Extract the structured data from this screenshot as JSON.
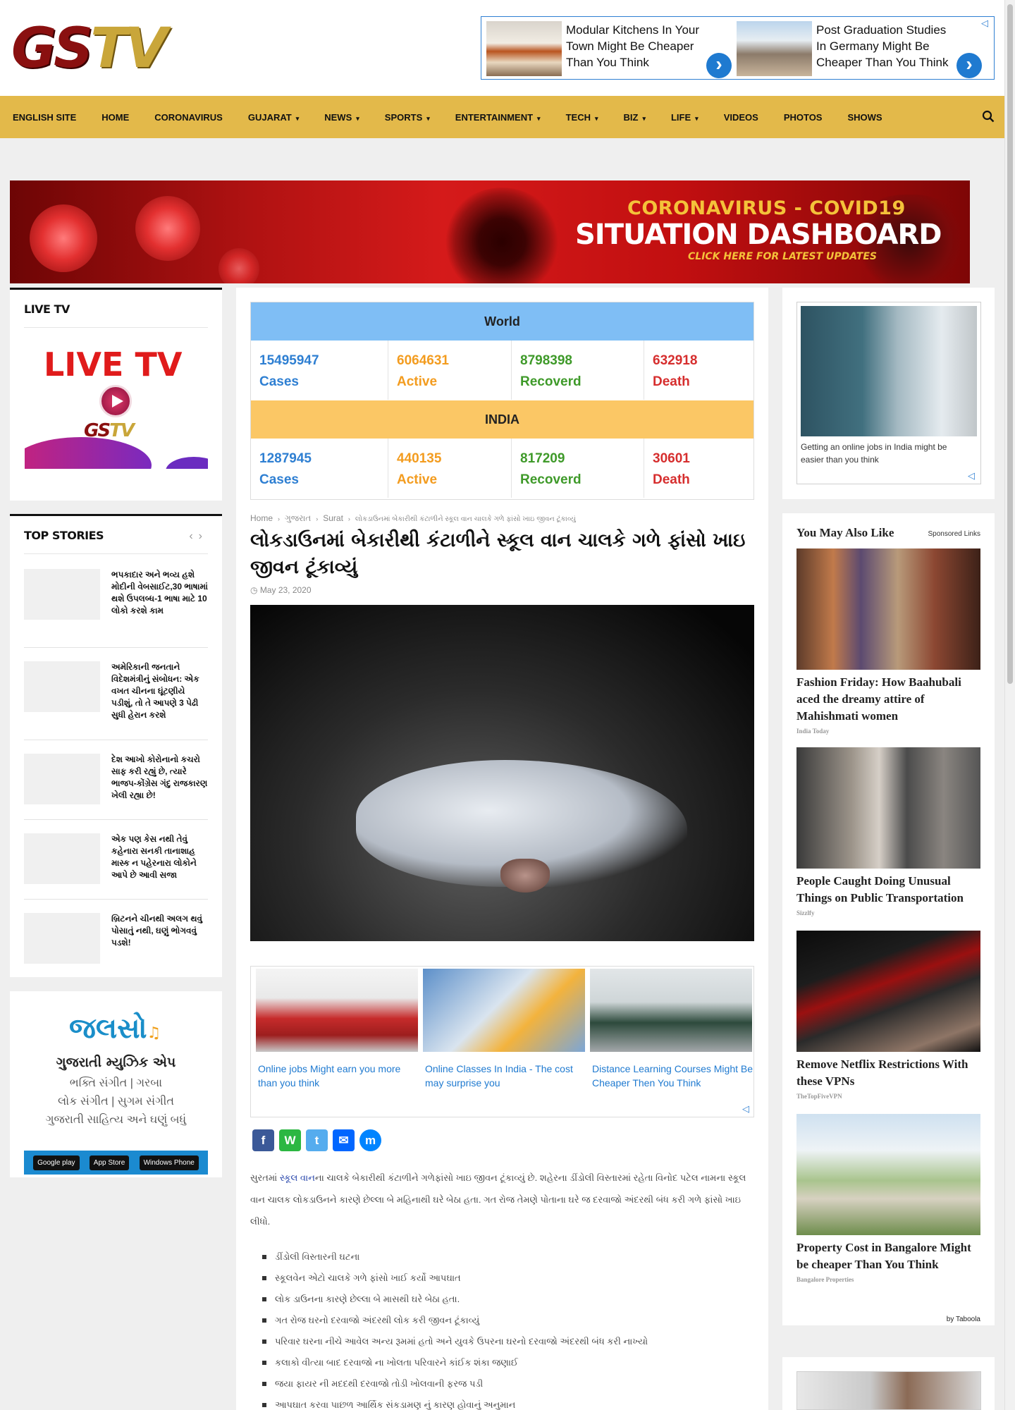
{
  "header": {
    "logo_part1": "GS",
    "logo_part2": "TV"
  },
  "top_ads": [
    {
      "text": "Modular Kitchens In Your Town Might Be Cheaper Than You Think",
      "arrow": "›"
    },
    {
      "text": "Post Graduation Studies In Germany Might Be Cheaper Than You Think",
      "arrow": "›"
    }
  ],
  "nav": {
    "items": [
      {
        "label": "ENGLISH SITE",
        "dropdown": false
      },
      {
        "label": "HOME",
        "dropdown": false
      },
      {
        "label": "CORONAVIRUS",
        "dropdown": false
      },
      {
        "label": "GUJARAT",
        "dropdown": true
      },
      {
        "label": "NEWS",
        "dropdown": true
      },
      {
        "label": "SPORTS",
        "dropdown": true
      },
      {
        "label": "ENTERTAINMENT",
        "dropdown": true
      },
      {
        "label": "TECH",
        "dropdown": true
      },
      {
        "label": "BIZ",
        "dropdown": true
      },
      {
        "label": "LIFE",
        "dropdown": true
      },
      {
        "label": "VIDEOS",
        "dropdown": false
      },
      {
        "label": "PHOTOS",
        "dropdown": false
      },
      {
        "label": "SHOWS",
        "dropdown": false
      }
    ],
    "caret": "▾",
    "search_icon": "search-icon"
  },
  "covid_banner": {
    "line1": "CORONAVIRUS - COVID19",
    "line2": "SITUATION DASHBOARD",
    "line3": "CLICK HERE FOR LATEST UPDATES"
  },
  "live_tv": {
    "title": "LIVE TV",
    "image_text": "LIVE TV",
    "logo_a": "GS",
    "logo_b": "TV"
  },
  "top_stories": {
    "title": "TOP STORIES",
    "prev": "‹",
    "next": "›",
    "items": [
      "ભપકાદાર અને ભવ્ય હશે મોદીની વેબસાઈટ,30 ભાષામાં થશે ઉપલબ્ધ-1 ભાષા માટે 10 લોકો કરશે કામ",
      "અમેરિકાની જનતાને વિદેશમંત્રીનું સંબોધન: એક વખત ચીનના ઘૂંટણીયે પડીશું, તો તે આપણે 3 પેઢી સુધી હેરાન કરશે",
      "દેશ આખો કોરોનાનો કચરો સાફ કરી રહ્યું છે, ત્યારે ભાજપ-કોંગ્રેસ ગંદુ રાજકારણ ખેલી રહ્યા છે!",
      "એક પણ કેસ નથી તેવું કહેનારા સનકી તાનાશાહ માસ્ક ન પહેરનારા લોકોને આપે છે આવી સજા",
      "બ્રિટનને ચીનથી અલગ થવું પોસાતું નથી, ઘણું ભોગવવું પડશે!"
    ]
  },
  "app_promo": {
    "logo": "જલસો",
    "note": "♫",
    "line1": "ગુજરાતી મ્યુઝિક એપ",
    "line2": "ભક્તિ સંગીત | ગરબા",
    "line3": "લોક સંગીત | સુગમ સંગીત",
    "line4": "ગુજરાતી સાહિત્ય અને ઘણું બધું",
    "stores": [
      "Google play",
      "App Store",
      "Windows Phone"
    ]
  },
  "stats": {
    "world": {
      "label": "World",
      "cells": [
        {
          "value": "15495947",
          "label": "Cases"
        },
        {
          "value": "6064631",
          "label": "Active"
        },
        {
          "value": "8798398",
          "label": "Recoverd"
        },
        {
          "value": "632918",
          "label": "Death"
        }
      ]
    },
    "india": {
      "label": "INDIA",
      "cells": [
        {
          "value": "1287945",
          "label": "Cases"
        },
        {
          "value": "440135",
          "label": "Active"
        },
        {
          "value": "817209",
          "label": "Recoverd"
        },
        {
          "value": "30601",
          "label": "Death"
        }
      ]
    },
    "colors": {
      "cases": "#2e7fd2",
      "active": "#f39c1f",
      "recovered": "#3f9a2a",
      "death": "#d62e2e",
      "world_band": "#7fbef5",
      "india_band": "#fbc765"
    }
  },
  "article": {
    "breadcrumb": [
      "Home",
      "ગુજરાત",
      "Surat",
      "લોકડાઉનમાં બેકારીથી કંટાળીને સ્કૂલ વાન ચાલકે ગળે ફાંસો ખાઇ જીવન ટૂંકાવ્યું"
    ],
    "breadcrumb_sep": "›",
    "title": "લોકડાઉનમાં બેકારીથી કંટાળીને સ્કૂલ વાન ચાલકે ગળે ફાંસો ખાઇ જીવન ટૂંકાવ્યું",
    "date": "May 23, 2020",
    "body_prefix": "સુરતમાં ",
    "body_link": "સ્કૂલ વાન",
    "body_rest": "ના ચાલકે બેકારીથી કંટાળીને ગળેફાંસો ખાઇ જીવન ટૂંકાવ્યું છે. શહેરના ડીંડોલી વિસ્તારમાં રહેતા વિનોદ પટેલ નામના સ્કૂલ વાન ચાલક લોકડાઉનને કારણે છેલ્લા બે મહિનાથી ઘરે બેઠા હતા. ગત રોજ તેમણે પોતાના ઘરે જ દરવાજો અંદરથી બંધ કરી ગળે ફાંસો ખાઇ લીધો.",
    "bullets": [
      "ડીંડોલી વિસ્તારની ઘટના",
      "સ્કૂલવેન એટો ચાલકે ગળે ફાંસો ખાઈ કર્યો આપઘાત",
      "લોક ડાઉનના કારણે છેલ્લા બે માસથી ઘરે બેઠા હતા.",
      "ગત રોજ ઘરનો દરવાજો અંદરથી લોક કરી જીવન ટૂંકાવ્યું",
      "પરિવાર ઘરના નીચે આવેલ અન્ય રૂમમાં હતો અને યુવકે ઉપરના ઘરનો દરવાજો અંદરથી બંધ કરી નાખ્યો",
      "કલાકો વીત્યા બાદ દરવાજો ના ખોલતા પરિવારને કાંઈક શંકા જણાઈ",
      "જયા ફાયર ની મદદથી દરવાજો તોડી ખોલવાની ફરજ પડી",
      "આપઘાત કરવા પાછળ આર્થિક સંકડામણ નું કારણ હોવાનું અનુમાન"
    ],
    "share": [
      "f",
      "W",
      "t",
      "✉",
      "m"
    ]
  },
  "mid_ads": [
    "Online jobs Might earn you more than you think",
    "Online Classes In India - The cost may surprise you",
    "Distance Learning Courses Might Be Cheaper Then You Think"
  ],
  "right_ad": {
    "caption": "Getting an online jobs in India might be easier than you think"
  },
  "taboola": {
    "heading": "You May Also Like",
    "sponsored": "Sponsored Links",
    "items": [
      {
        "title": "Fashion Friday: How Baahubali aced the dreamy attire of Mahishmati women",
        "source": "India Today"
      },
      {
        "title": "People Caught Doing Unusual Things on Public Transportation",
        "source": "Sizzlfy"
      },
      {
        "title": "Remove Netflix Restrictions With these VPNs",
        "source": "TheTopFiveVPN"
      },
      {
        "title": "Property Cost in Bangalore Might be cheaper Than You Think",
        "source": "Bangalore Properties"
      }
    ],
    "by": "by Taboola"
  }
}
